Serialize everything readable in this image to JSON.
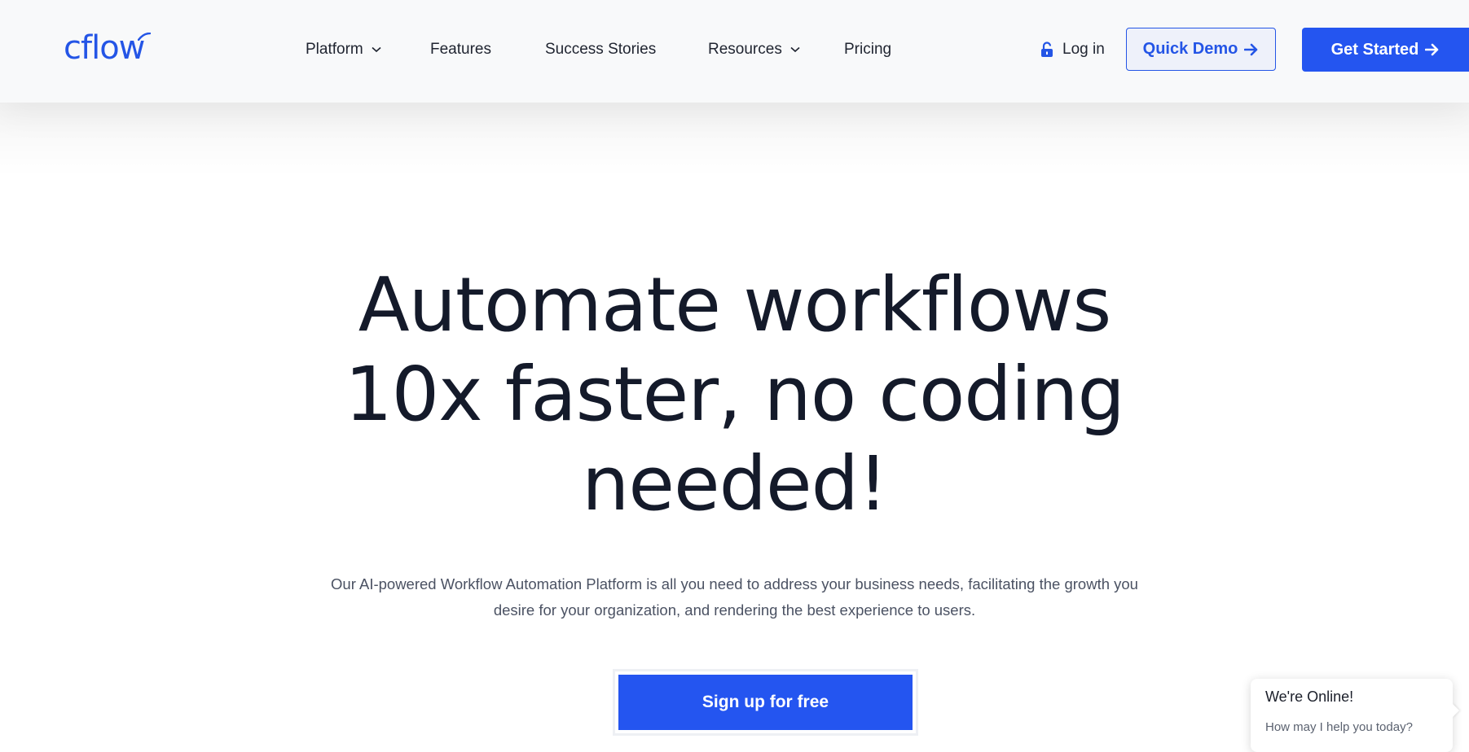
{
  "header": {
    "logo_text": "cflow",
    "nav": [
      {
        "label": "Platform",
        "has_dropdown": true
      },
      {
        "label": "Features",
        "has_dropdown": false
      },
      {
        "label": "Success Stories",
        "has_dropdown": false
      },
      {
        "label": "Resources",
        "has_dropdown": true
      },
      {
        "label": "Pricing",
        "has_dropdown": false
      }
    ],
    "login_label": "Log in",
    "quick_demo_label": "Quick Demo",
    "get_started_label": "Get Started"
  },
  "hero": {
    "title_lines": [
      "Automate workflows",
      "10x faster, no coding",
      "needed!"
    ],
    "subtitle": "Our AI-powered Workflow Automation Platform is all you need to address your business needs, facilitating the growth you desire for your organization, and rendering the best experience to users.",
    "cta_label": "Sign up for free"
  },
  "chat": {
    "title": "We're Online!",
    "message": "How may I help you today?"
  },
  "icons": {
    "lock": "lock-open-icon",
    "chevron": "chevron-down-icon",
    "arrow": "arrow-right-icon"
  },
  "colors": {
    "brand": "#2455f0",
    "header_bg": "#f8f9fa",
    "title_text": "#141a2a"
  }
}
